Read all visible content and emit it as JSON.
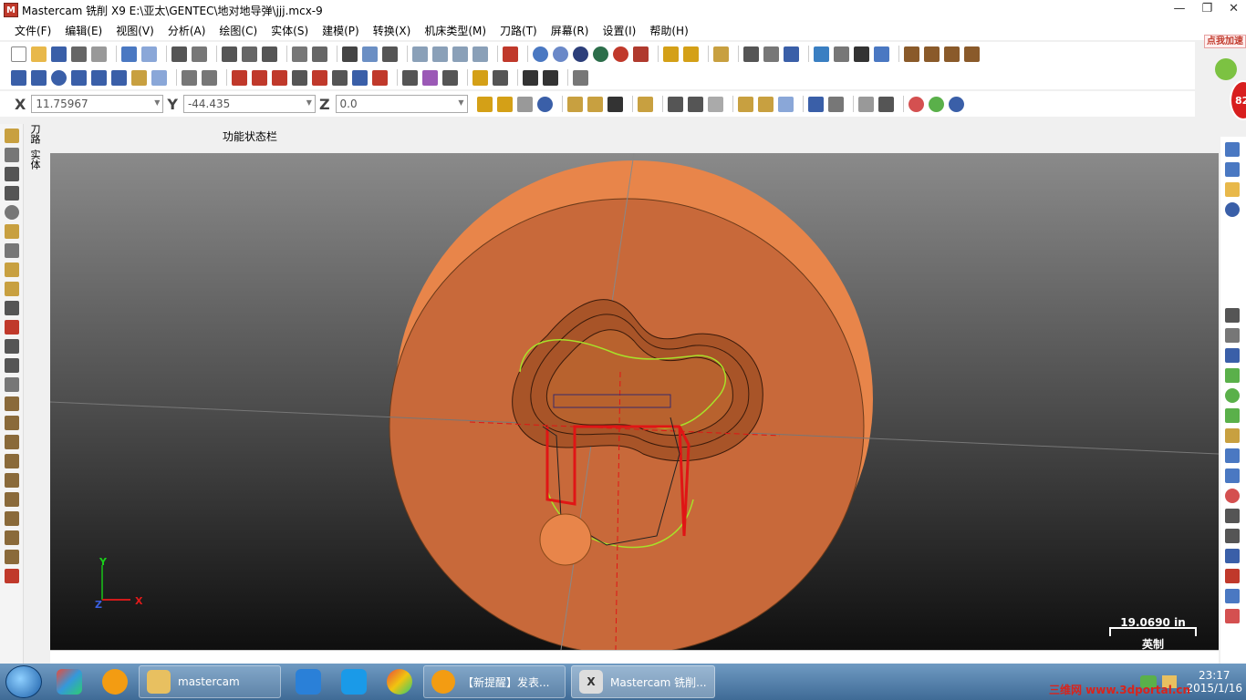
{
  "window": {
    "title": "Mastercam 铣削 X9  E:\\亚太\\GENTEC\\地对地导弹\\jjj.mcx-9",
    "buttons": {
      "minimize": "—",
      "restore": "❐",
      "close": "✕"
    }
  },
  "menu": [
    "文件(F)",
    "编辑(E)",
    "视图(V)",
    "分析(A)",
    "绘图(C)",
    "实体(S)",
    "建模(P)",
    "转换(X)",
    "机床类型(M)",
    "刀路(T)",
    "屏幕(R)",
    "设置(I)",
    "帮助(H)"
  ],
  "coords": {
    "x_label": "X",
    "x_value": "11.75967",
    "y_label": "Y",
    "y_value": "-44.435",
    "z_label": "Z",
    "z_value": "0.0"
  },
  "left_tabs": [
    "刀路",
    "实体"
  ],
  "status_bar_label": "功能状态栏",
  "scale": {
    "value": "19.0690 in",
    "unit": "英制"
  },
  "axis_labels": {
    "x": "X",
    "y": "Y",
    "z": "Z"
  },
  "ad": {
    "label": "点我加速",
    "count": "82"
  },
  "taskbar": {
    "tasks": [
      {
        "label": "mastercam",
        "icon": "folder-icon"
      },
      {
        "label": "【新提醒】发表...",
        "icon": "orange-icon"
      },
      {
        "label": "Mastercam 铣削...",
        "icon": "mastercam-icon"
      }
    ],
    "clock_time": "23:17",
    "clock_date": "2015/1/16"
  },
  "watermark": "三维网 www.3dportal.cn",
  "colors": {
    "part": "#c8693a",
    "toolpath_red": "#e01515",
    "toolpath_green": "#a8e02a",
    "viewport_top": "#8a8a8a",
    "viewport_bottom": "#0f0f0f"
  }
}
